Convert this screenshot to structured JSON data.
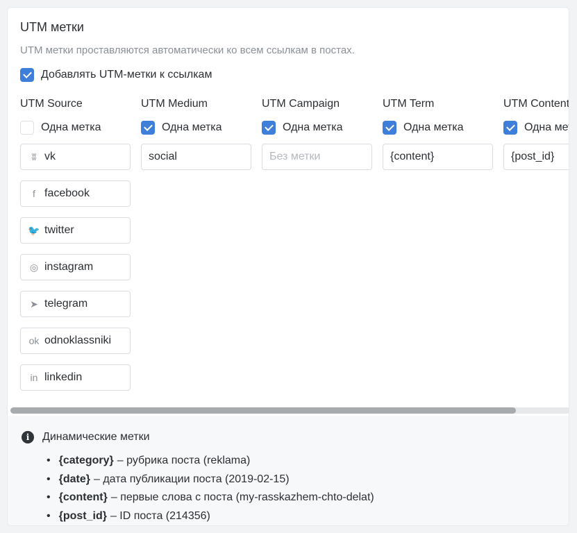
{
  "title": "UTM метки",
  "description": "UTM метки проставляются автоматически ко всем ссылкам в постах.",
  "add_utm": {
    "label": "Добавлять UTM-метки к ссылкам",
    "checked": true
  },
  "accent": "#3d7fd9",
  "columns": [
    {
      "header": "UTM Source",
      "single_label": "Одна метка",
      "single": false,
      "inputs": [
        {
          "icon": "vk-icon",
          "glyph": "ʬ",
          "value": "vk"
        },
        {
          "icon": "facebook-icon",
          "glyph": "f",
          "value": "facebook"
        },
        {
          "icon": "twitter-icon",
          "glyph": "🐦",
          "value": "twitter"
        },
        {
          "icon": "instagram-icon",
          "glyph": "◎",
          "value": "instagram"
        },
        {
          "icon": "telegram-icon",
          "glyph": "➤",
          "value": "telegram"
        },
        {
          "icon": "odnoklassniki-icon",
          "glyph": "ok",
          "value": "odnoklassniki"
        },
        {
          "icon": "linkedin-icon",
          "glyph": "in",
          "value": "linkedin"
        }
      ]
    },
    {
      "header": "UTM Medium",
      "single_label": "Одна метка",
      "single": true,
      "inputs": [
        {
          "value": "social"
        }
      ]
    },
    {
      "header": "UTM Campaign",
      "single_label": "Одна метка",
      "single": true,
      "inputs": [
        {
          "value": "",
          "placeholder": "Без метки"
        }
      ]
    },
    {
      "header": "UTM Term",
      "single_label": "Одна метка",
      "single": true,
      "inputs": [
        {
          "value": "{content}"
        }
      ]
    },
    {
      "header": "UTM Content",
      "single_label": "Одна метка",
      "single": true,
      "inputs": [
        {
          "value": "{post_id}"
        }
      ]
    }
  ],
  "dynamic": {
    "title": "Динамические метки",
    "items": [
      {
        "key": "{category}",
        "text": "– рубрика поста (reklama)"
      },
      {
        "key": "{date}",
        "text": "– дата публикации поста (2019-02-15)"
      },
      {
        "key": "{content}",
        "text": "– первые слова с поста (my-rasskazhem-chto-delat)"
      },
      {
        "key": "{post_id}",
        "text": "– ID поста (214356)"
      }
    ]
  }
}
